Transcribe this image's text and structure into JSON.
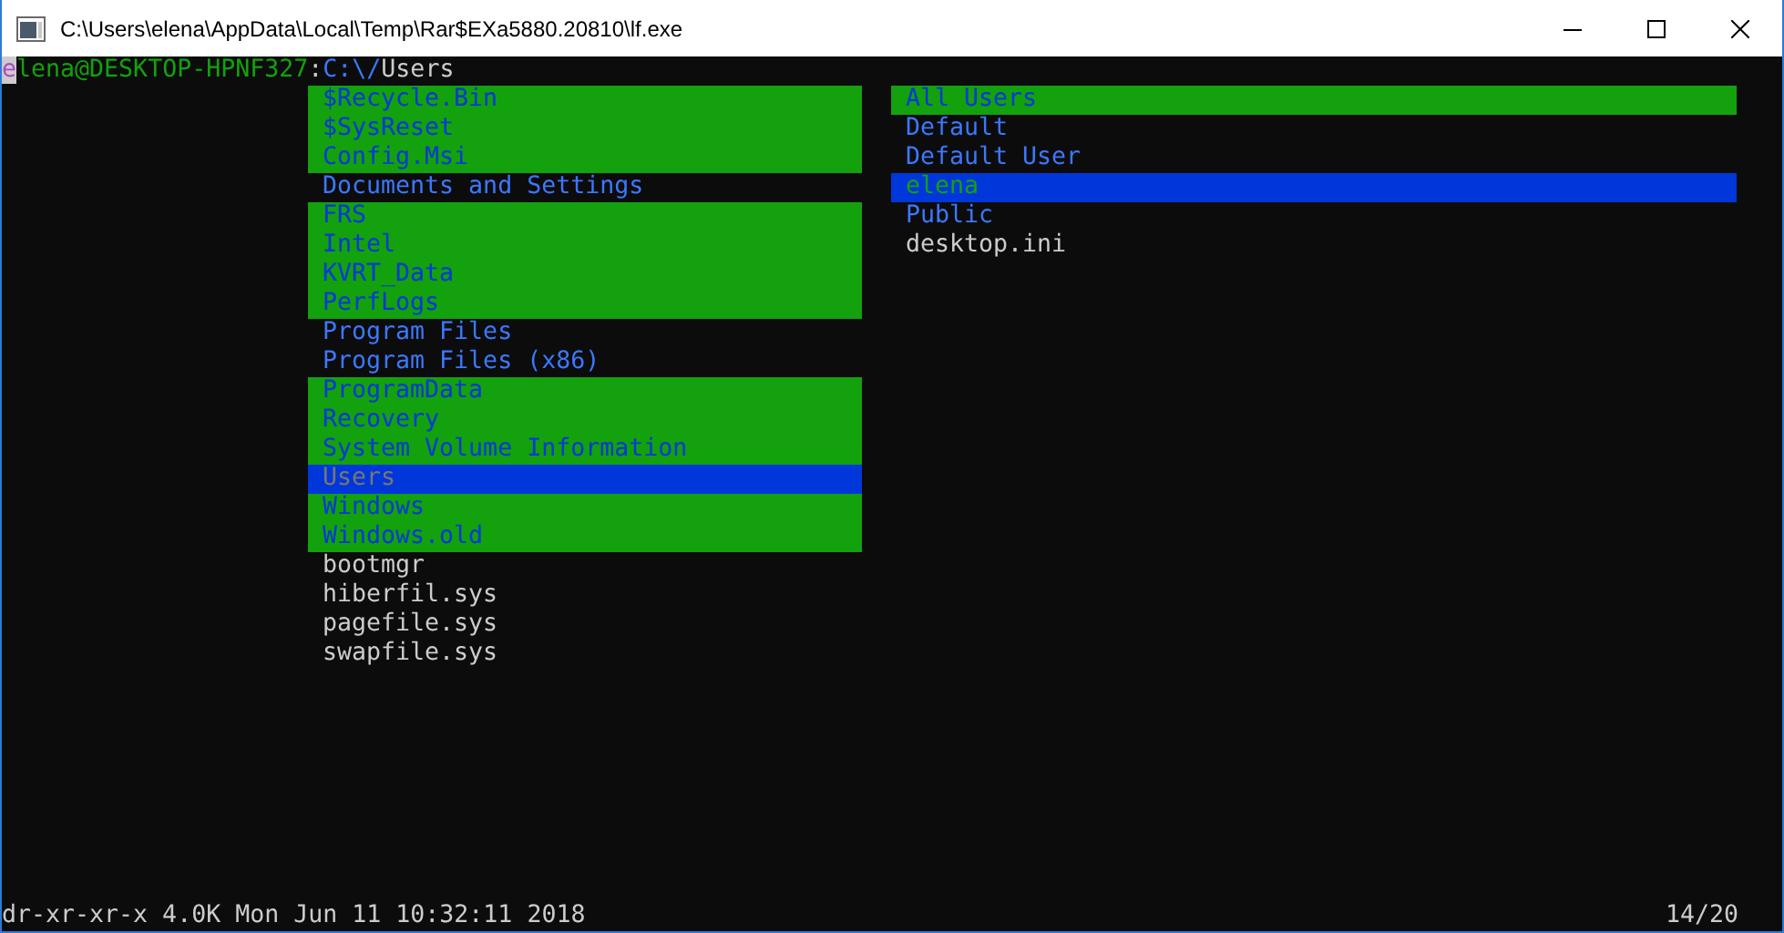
{
  "window": {
    "title": "C:\\Users\\elena\\AppData\\Local\\Temp\\Rar$EXa5880.20810\\lf.exe"
  },
  "prompt": {
    "user": "elena",
    "host": "@DESKTOP-HPNF327",
    "separator": ":",
    "path": "C:\\/",
    "name": "Users"
  },
  "current_pane": [
    {
      "name": "$Recycle.Bin",
      "kind": "dir",
      "hidden": true,
      "selected": false
    },
    {
      "name": "$SysReset",
      "kind": "dir",
      "hidden": true,
      "selected": false
    },
    {
      "name": "Config.Msi",
      "kind": "dir",
      "hidden": true,
      "selected": false
    },
    {
      "name": "Documents and Settings",
      "kind": "dir",
      "hidden": false,
      "selected": false
    },
    {
      "name": "FRS",
      "kind": "dir",
      "hidden": true,
      "selected": false
    },
    {
      "name": "Intel",
      "kind": "dir",
      "hidden": true,
      "selected": false
    },
    {
      "name": "KVRT_Data",
      "kind": "dir",
      "hidden": true,
      "selected": false
    },
    {
      "name": "PerfLogs",
      "kind": "dir",
      "hidden": true,
      "selected": false
    },
    {
      "name": "Program Files",
      "kind": "dir",
      "hidden": false,
      "selected": false
    },
    {
      "name": "Program Files (x86)",
      "kind": "dir",
      "hidden": false,
      "selected": false
    },
    {
      "name": "ProgramData",
      "kind": "dir",
      "hidden": true,
      "selected": false
    },
    {
      "name": "Recovery",
      "kind": "dir",
      "hidden": true,
      "selected": false
    },
    {
      "name": "System Volume Information",
      "kind": "dir",
      "hidden": true,
      "selected": false
    },
    {
      "name": "Users",
      "kind": "dir",
      "hidden": true,
      "selected": true
    },
    {
      "name": "Windows",
      "kind": "dir",
      "hidden": true,
      "selected": false
    },
    {
      "name": "Windows.old",
      "kind": "dir",
      "hidden": true,
      "selected": false
    },
    {
      "name": "bootmgr",
      "kind": "file",
      "hidden": false,
      "selected": false
    },
    {
      "name": "hiberfil.sys",
      "kind": "file",
      "hidden": false,
      "selected": false
    },
    {
      "name": "pagefile.sys",
      "kind": "file",
      "hidden": false,
      "selected": false
    },
    {
      "name": "swapfile.sys",
      "kind": "file",
      "hidden": false,
      "selected": false
    }
  ],
  "preview_pane": [
    {
      "name": "All Users",
      "kind": "dir",
      "hidden": true,
      "selected": false
    },
    {
      "name": "Default",
      "kind": "dir",
      "hidden": false,
      "selected": false
    },
    {
      "name": "Default User",
      "kind": "dir",
      "hidden": false,
      "selected": false
    },
    {
      "name": "elena",
      "kind": "dir",
      "hidden": false,
      "selected": true
    },
    {
      "name": "Public",
      "kind": "dir",
      "hidden": false,
      "selected": false
    },
    {
      "name": "desktop.ini",
      "kind": "file",
      "hidden": false,
      "selected": false
    }
  ],
  "status_bar": {
    "info": "dr-xr-xr-x 4.0K Mon Jun 11 10:32:11 2018",
    "position": "14/20"
  }
}
